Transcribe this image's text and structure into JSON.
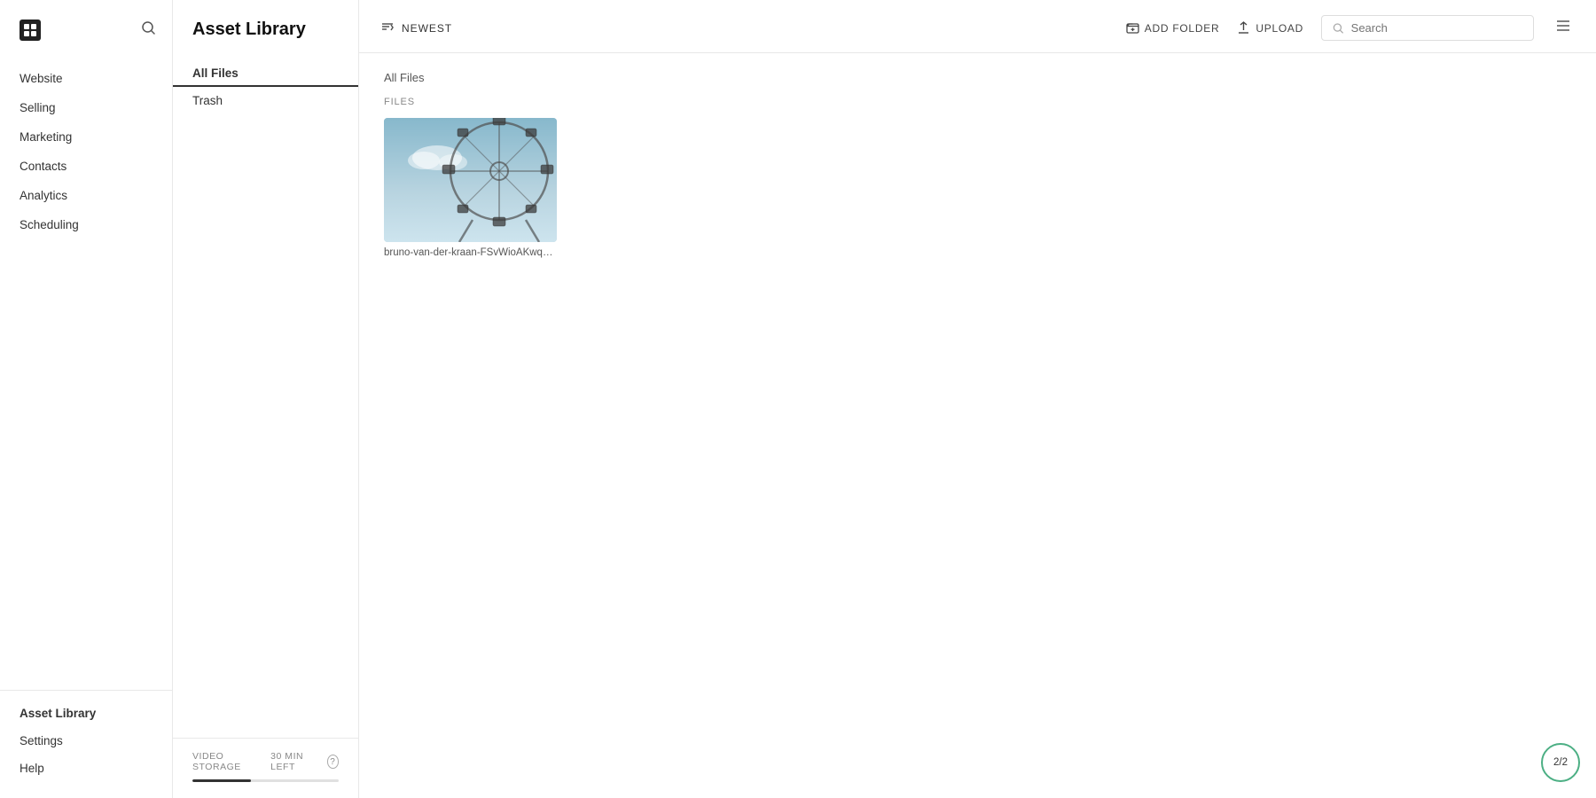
{
  "sidebar": {
    "logo_label": "Squarespace",
    "nav_items": [
      {
        "id": "website",
        "label": "Website"
      },
      {
        "id": "selling",
        "label": "Selling"
      },
      {
        "id": "marketing",
        "label": "Marketing"
      },
      {
        "id": "contacts",
        "label": "Contacts"
      },
      {
        "id": "analytics",
        "label": "Analytics"
      },
      {
        "id": "scheduling",
        "label": "Scheduling"
      }
    ],
    "bottom_items": [
      {
        "id": "asset-library",
        "label": "Asset Library",
        "active": true
      },
      {
        "id": "settings",
        "label": "Settings"
      },
      {
        "id": "help",
        "label": "Help"
      }
    ]
  },
  "secondary_sidebar": {
    "title": "Asset Library",
    "nav_items": [
      {
        "id": "all-files",
        "label": "All Files",
        "active": true
      },
      {
        "id": "trash",
        "label": "Trash"
      }
    ],
    "footer": {
      "storage_label": "VIDEO STORAGE",
      "storage_time": "30 MIN LEFT",
      "help_title": "Help"
    }
  },
  "toolbar": {
    "sort_label": "NEWEST",
    "search_placeholder": "Search",
    "add_folder_label": "ADD FOLDER",
    "upload_label": "UPLOAD"
  },
  "main": {
    "breadcrumb": "All Files",
    "section_label": "FILES",
    "files": [
      {
        "id": "ferris-wheel",
        "name": "bruno-van-der-kraan-FSvWioAKwqU-unsplas..."
      }
    ]
  },
  "page_counter": {
    "label": "2/2"
  }
}
